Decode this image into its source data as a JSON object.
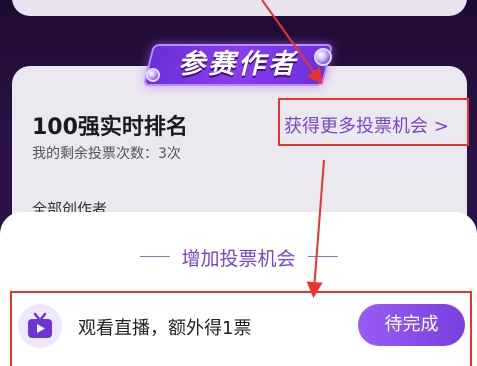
{
  "section": {
    "banner_label": "参赛作者"
  },
  "ranking": {
    "title": "100强实时排名",
    "remaining_votes": "我的剩余投票次数：3次",
    "more_chances_link": "获得更多投票机会 >",
    "all_authors_tab": "全部创作者"
  },
  "sheet": {
    "title": "增加投票机会",
    "task": {
      "label": "观看直播，额外得1票",
      "button_label": "待完成",
      "icon": "tv-icon"
    }
  },
  "colors": {
    "accent": "#7a45c9",
    "button": "#8a4cec",
    "annotation": "#e8352c",
    "background": "#2a1246"
  }
}
